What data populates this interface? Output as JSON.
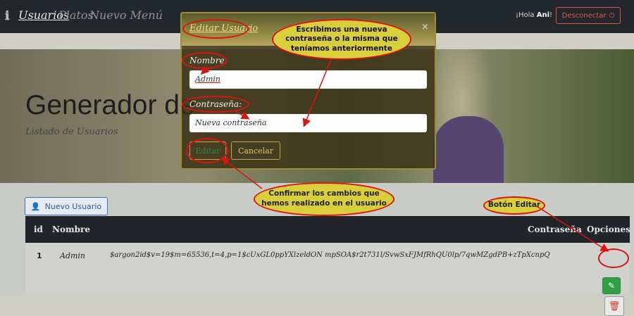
{
  "nav": {
    "info_icon": "info-icon",
    "links": [
      "Usuarios",
      "Platos",
      "Nuevo Menú"
    ],
    "greeting_prefix": "¡Hola ",
    "greeting_user": "Ani",
    "greeting_suffix": "!",
    "logout_label": "Desconectar",
    "logout_icon": "power-icon"
  },
  "hero": {
    "title": "Generador de",
    "subtitle": "Listado de Usuarios"
  },
  "toolbar": {
    "new_user_label": "Nuevo Usuario",
    "new_user_icon": "user-plus-icon"
  },
  "table": {
    "columns": [
      "id",
      "Nombre",
      "Contraseña",
      "Opciones"
    ],
    "rows": [
      {
        "id": "1",
        "name": "Admin",
        "password": "$argon2id$v=19$m=65536,t=4,p=1$cUxGL0ppYXlzeldON mpSOA$r2t731l/SvwSxFJMfRhQU0lp/7qwMZgdPB+zTpXcnpQ"
      }
    ]
  },
  "modal": {
    "title": "Editar Usuario",
    "close_symbol": "×",
    "name_label": "Nombre:",
    "name_value": "Admin",
    "password_label": "Contraseña:",
    "password_placeholder": "Nueva contraseña",
    "save_label": "Editar",
    "cancel_label": "Cancelar"
  },
  "annotations": {
    "password_note": "Escribimos una nueva contraseña o la misma que teníamos anteriormente",
    "confirm_note": "Confirmar los cambios que hemos realizado en el usuario",
    "edit_button_note": "Botón Editar"
  },
  "colors": {
    "navbar": "#22272b",
    "callout_fill": "#d9cf3d",
    "callout_border": "#dd1111",
    "edit_green": "#2f9e44",
    "delete_red": "#d23b2b"
  }
}
